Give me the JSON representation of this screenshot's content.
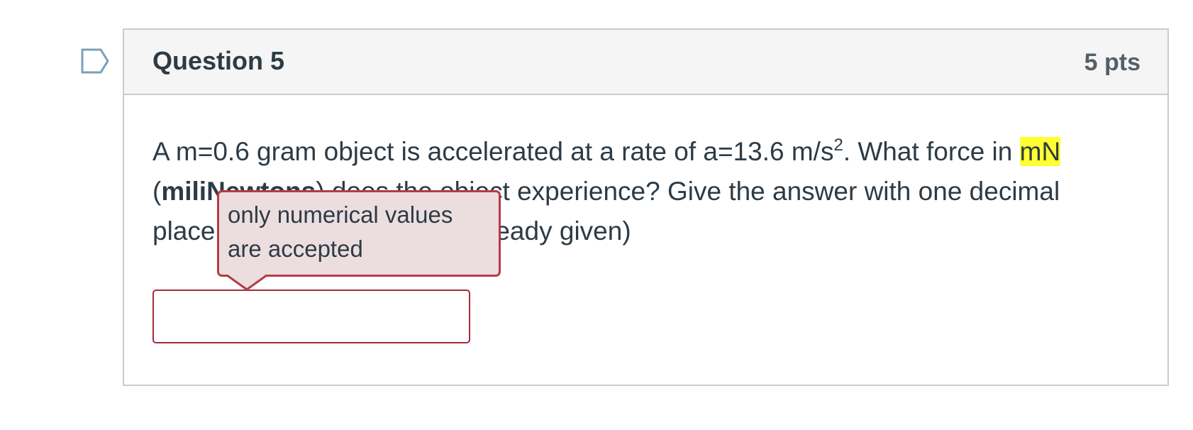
{
  "question": {
    "title": "Question 5",
    "points": "5 pts",
    "text_part1": "A m=0.6 gram object is accelerated at a rate of a=13.6 m/s",
    "superscript": "2",
    "text_part2": ".  What force in ",
    "highlighted_unit": "mN",
    "line2_open": "(",
    "bold_unit": "miliNewtons",
    "line2_rest": ") does the object experience? Give the answer with one decimal",
    "line3": "place and without the unit (already given)",
    "flag_icon": "bookmark-flag-icon"
  },
  "answer": {
    "value": "",
    "placeholder": ""
  },
  "tooltip": {
    "message": "only numerical values are accepted"
  },
  "colors": {
    "error_border": "#a52a3d",
    "tooltip_bg": "#ecdedf",
    "highlight": "#ffff33",
    "header_bg": "#f5f5f5"
  }
}
